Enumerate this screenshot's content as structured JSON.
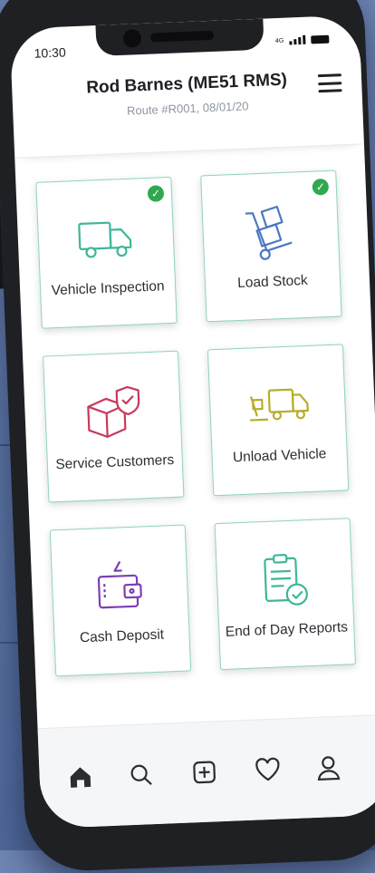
{
  "status": {
    "time": "10:30",
    "network": "4G"
  },
  "header": {
    "driver": "Rod Barnes (ME51 RMS)",
    "route": "Route #R001, 08/01/20"
  },
  "tiles": [
    {
      "label": "Vehicle Inspection",
      "icon": "truck-icon",
      "completed": true,
      "color": "#3fb69a"
    },
    {
      "label": "Load Stock",
      "icon": "hand-truck-icon",
      "completed": true,
      "color": "#4b78c2"
    },
    {
      "label": "Service Customers",
      "icon": "box-shield-icon",
      "completed": false,
      "color": "#c9395a"
    },
    {
      "label": "Unload Vehicle",
      "icon": "unload-truck-icon",
      "completed": false,
      "color": "#b7ad2a"
    },
    {
      "label": "Cash Deposit",
      "icon": "wallet-icon",
      "completed": false,
      "color": "#7b3fb3"
    },
    {
      "label": "End of Day Reports",
      "icon": "clipboard-check-icon",
      "completed": false,
      "color": "#3fb69a"
    }
  ],
  "nav": [
    "home-icon",
    "search-icon",
    "add-icon",
    "heart-icon",
    "profile-icon"
  ]
}
